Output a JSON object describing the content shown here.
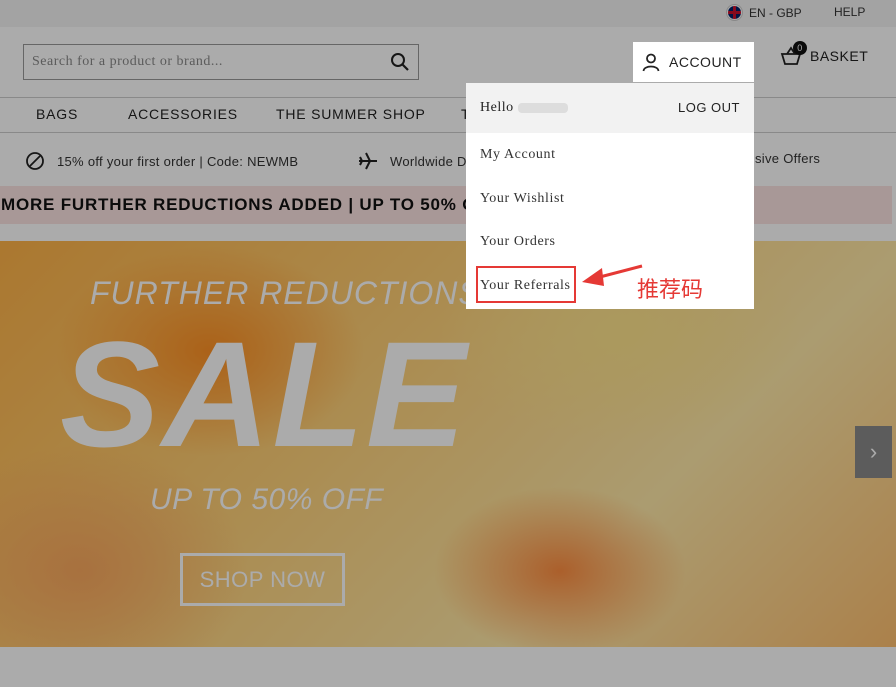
{
  "topbar": {
    "lang_label": "EN - GBP",
    "help_label": "HELP"
  },
  "header": {
    "search_placeholder": "Search for a product or brand...",
    "account_label": "ACCOUNT",
    "basket_label": "BASKET",
    "basket_count": "0"
  },
  "nav": {
    "items": [
      "BAGS",
      "ACCESSORIES",
      "THE SUMMER SHOP",
      "T"
    ]
  },
  "usp": {
    "offer_text": "15% off your first order | Code: NEWMB",
    "delivery_text": "Worldwide De",
    "exclusive_text": "sive Offers"
  },
  "promo": {
    "text": "MORE FURTHER REDUCTIONS ADDED | UP TO 50% OFF"
  },
  "hero": {
    "line1": "FURTHER REDUCTIONS",
    "headline": "SALE",
    "line2": "UP TO 50% OFF",
    "button_label": "SHOP NOW",
    "next_label": "›"
  },
  "account_menu": {
    "greeting": "Hello",
    "logout_label": "LOG OUT",
    "items": [
      "My Account",
      "Your Wishlist",
      "Your Orders",
      "Your Referrals"
    ]
  },
  "annotation": {
    "text": "推荐码",
    "color": "#e53935"
  },
  "colors": {
    "promo_bg": "#fbe3e1",
    "hero_orange": "#ffb347"
  }
}
